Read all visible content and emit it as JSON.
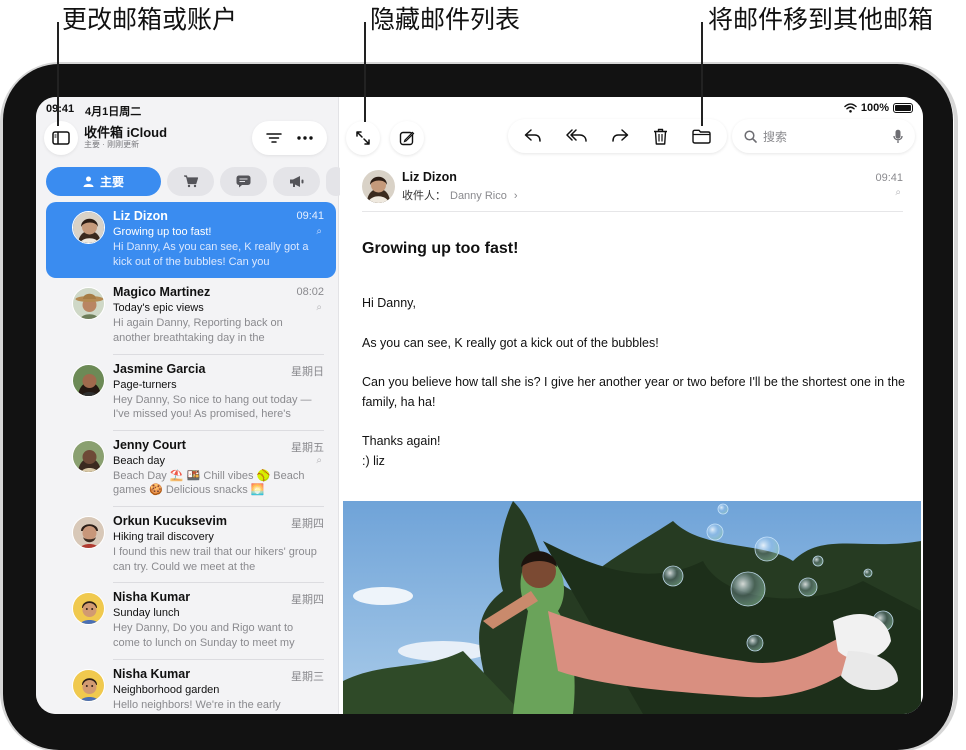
{
  "callouts": {
    "change_mailbox": "更改邮箱或账户",
    "hide_list": "隐藏邮件列表",
    "move_message": "将邮件移到其他邮箱"
  },
  "status": {
    "time": "09:41",
    "date": "4月1日周二",
    "battery": "100%"
  },
  "sidebar": {
    "title": "收件箱 iCloud",
    "subtitle": "主要 · 刚刚更新",
    "categories": {
      "primary": "主要"
    }
  },
  "messages": [
    {
      "sender": "Liz Dizon",
      "time": "09:41",
      "subject": "Growing up too fast!",
      "preview": "Hi Danny, As you can see, K really got a kick out of the bubbles! Can you",
      "attachment": true,
      "selected": true
    },
    {
      "sender": "Magico Martinez",
      "time": "08:02",
      "subject": "Today's epic views",
      "preview": "Hi again Danny, Reporting back on another breathtaking day in the",
      "attachment": true
    },
    {
      "sender": "Jasmine Garcia",
      "time": "星期日",
      "subject": "Page-turners",
      "preview": "Hey Danny, So nice to hang out today —I've missed you! As promised, here's",
      "attachment": false
    },
    {
      "sender": "Jenny Court",
      "time": "星期五",
      "subject": "Beach day",
      "preview": "Beach Day ⛱️ 🍱 Chill vibes 🥎 Beach games 🍪 Delicious snacks 🌅",
      "attachment": true
    },
    {
      "sender": "Orkun Kucuksevim",
      "time": "星期四",
      "subject": "Hiking trail discovery",
      "preview": "I found this new trail that our hikers' group can try. Could we meet at the",
      "attachment": false
    },
    {
      "sender": "Nisha Kumar",
      "time": "星期四",
      "subject": "Sunday lunch",
      "preview": "Hey Danny, Do you and Rigo want to come to lunch on Sunday to meet my",
      "attachment": false
    },
    {
      "sender": "Nisha Kumar",
      "time": "星期三",
      "subject": "Neighborhood garden",
      "preview": "Hello neighbors! We're in the early",
      "attachment": false
    }
  ],
  "toolbar": {
    "search_placeholder": "搜索"
  },
  "message": {
    "from": "Liz Dizon",
    "to_label": "收件人：",
    "to_name": "Danny Rico",
    "time": "09:41",
    "subject": "Growing up too fast!",
    "greeting": "Hi Danny,",
    "p1": "As you can see, K really got a kick out of the bubbles!",
    "p2": "Can you believe how tall she is? I give her another year or two before I'll be the shortest one in the family, ha ha!",
    "thanks": "Thanks again!",
    "sign": ":) liz"
  },
  "colors": {
    "accent": "#3a8cf0",
    "sidebar_bg": "#f3f3f5"
  }
}
